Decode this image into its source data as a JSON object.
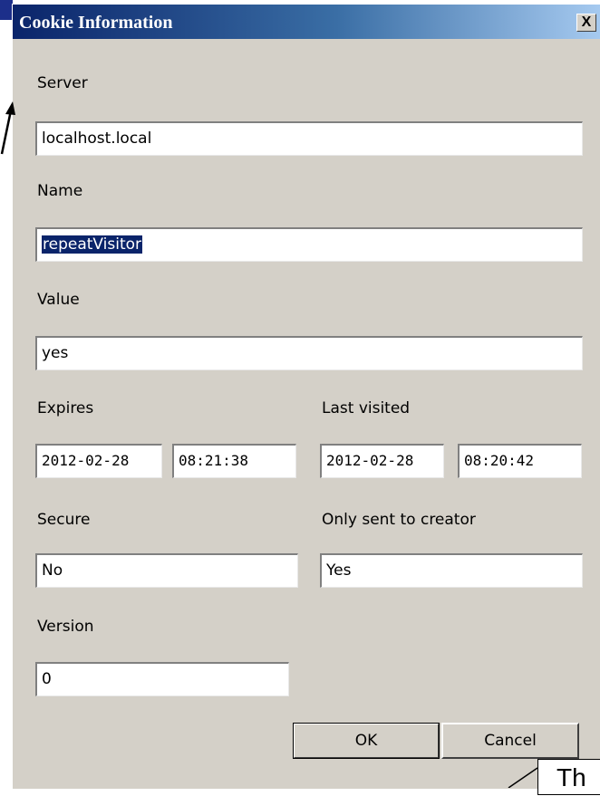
{
  "dialog": {
    "title": "Cookie Information",
    "close_glyph": "X"
  },
  "fields": {
    "server": {
      "label": "Server",
      "value": "localhost.local"
    },
    "name": {
      "label": "Name",
      "value": "repeatVisitor"
    },
    "value": {
      "label": "Value",
      "value": "yes"
    },
    "expires": {
      "label": "Expires",
      "date": "2012-02-28",
      "time": "08:21:38"
    },
    "last_visited": {
      "label": "Last visited",
      "date": "2012-02-28",
      "time": "08:20:42"
    },
    "secure": {
      "label": "Secure",
      "value": "No"
    },
    "only_sent_to_creator": {
      "label": "Only sent to creator",
      "value": "Yes"
    },
    "version": {
      "label": "Version",
      "value": "0"
    }
  },
  "buttons": {
    "ok": "OK",
    "cancel": "Cancel"
  },
  "callout": {
    "text": "Th"
  },
  "colors": {
    "title_start": "#0a246a",
    "title_end": "#a6caf0",
    "face": "#d4d0c8",
    "selection": "#0a246a"
  },
  "icons": [
    "close-icon",
    "pointer-arrow-icon"
  ]
}
